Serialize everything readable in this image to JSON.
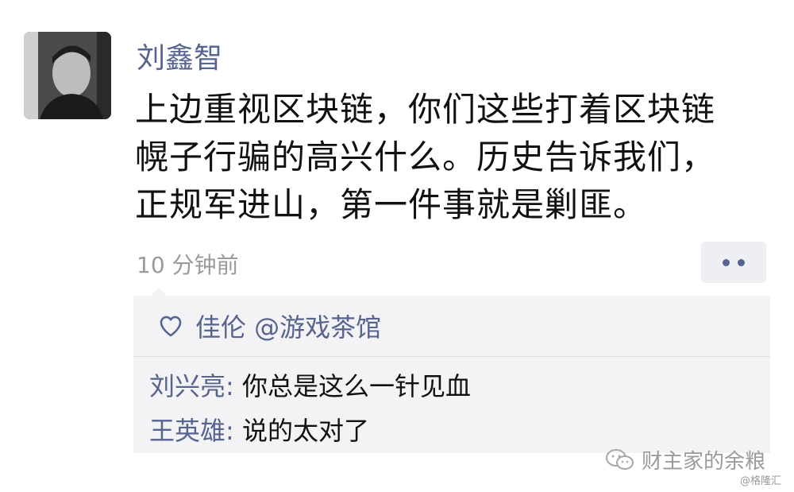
{
  "post": {
    "author": "刘鑫智",
    "lines": [
      "上边重视区块链，你们这些打着区块链",
      "幌子行骗的高兴什么。历史告诉我们，",
      "正规军进山，第一件事就是剿匪。"
    ],
    "time": "10 分钟前"
  },
  "likes": {
    "icon": "heart-icon",
    "text": "佳伦 @游戏茶馆"
  },
  "comments": [
    {
      "name": "刘兴亮",
      "text": "你总是这么一针见血"
    },
    {
      "name": "王英雄",
      "text": "说的太对了"
    }
  ],
  "watermark": {
    "icon": "wechat-icon",
    "text": "财主家的余粮",
    "credit": "@格隆汇"
  },
  "colors": {
    "name_blue": "#56648f",
    "text": "#111111",
    "muted": "#9a9a9a",
    "panel_bg": "#f3f3f5"
  }
}
